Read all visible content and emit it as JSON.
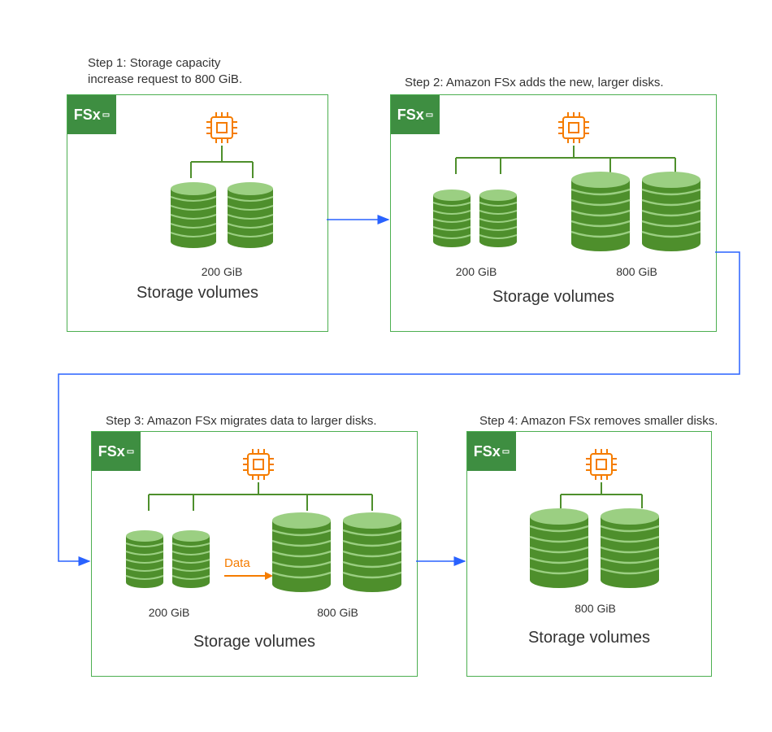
{
  "steps": {
    "s1": {
      "label": "Step 1: Storage capacity\nincrease request to 800 GiB.",
      "badge": "FSx",
      "small_label": "200 GiB",
      "caption": "Storage volumes"
    },
    "s2": {
      "label": "Step 2: Amazon FSx adds the new, larger disks.",
      "badge": "FSx",
      "small_label": "200 GiB",
      "large_label": "800 GiB",
      "caption": "Storage volumes"
    },
    "s3": {
      "label": "Step 3: Amazon FSx migrates data to larger disks.",
      "badge": "FSx",
      "small_label": "200 GiB",
      "large_label": "800 GiB",
      "caption": "Storage volumes",
      "data_arrow_label": "Data"
    },
    "s4": {
      "label": "Step 4: Amazon FSx removes  smaller disks.",
      "badge": "FSx",
      "large_label": "800 GiB",
      "caption": "Storage volumes"
    }
  },
  "colors": {
    "box_border": "#4CAF50",
    "badge": "#3E8E41",
    "cpu": "#F57C00",
    "disk_dark": "#4E8F2C",
    "disk_light": "#9BCF82",
    "arrow": "#2962FF"
  }
}
